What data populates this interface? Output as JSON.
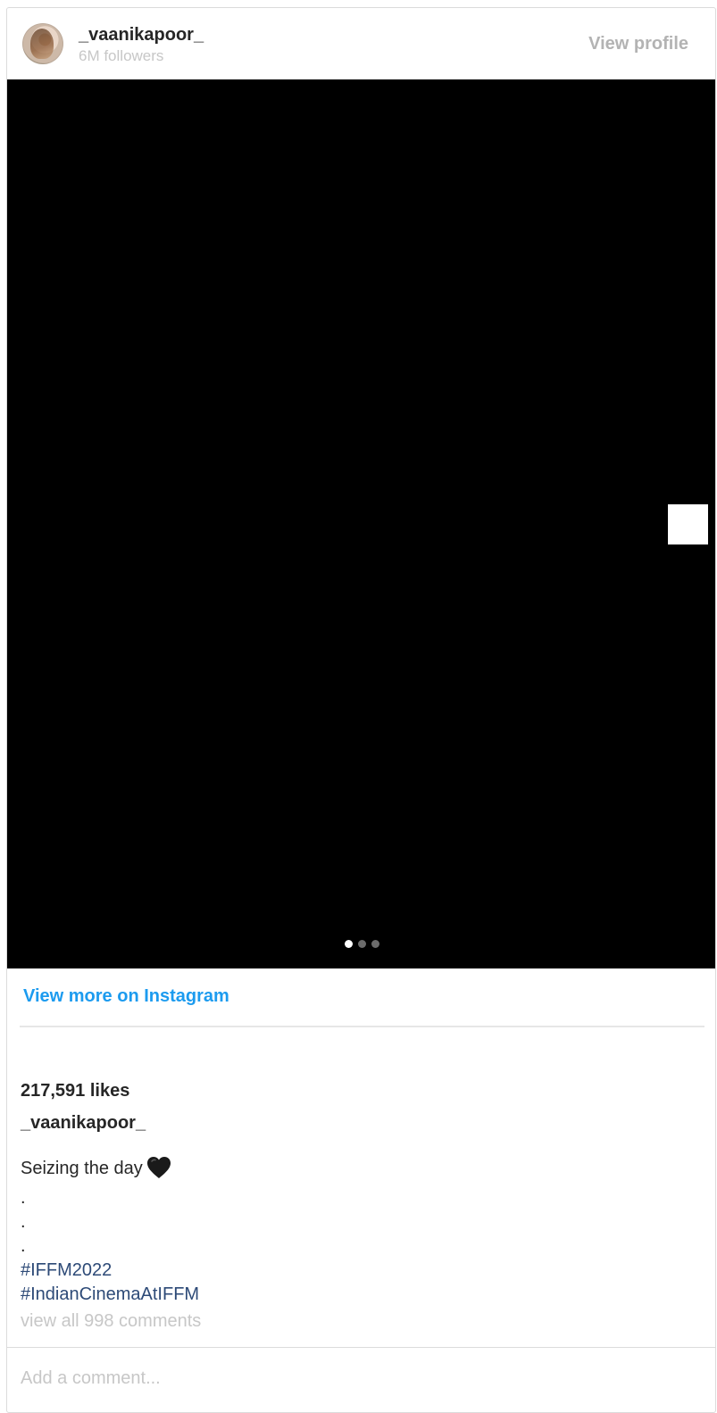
{
  "header": {
    "username": "_vaanikapoor_",
    "followers": "6M followers",
    "view_profile": "View profile"
  },
  "media": {
    "dots_total": 3,
    "active_dot": 1
  },
  "links": {
    "view_more": "View more on Instagram"
  },
  "post": {
    "likes": "217,591 likes",
    "caption_user": "_vaanikapoor_",
    "caption_text": "Seizing the day",
    "caption_dots": [
      ".",
      ".",
      "."
    ],
    "hashtags": [
      "#IFFM2022",
      "#IndianCinemaAtIFFM"
    ],
    "comments_link": "view all 998 comments"
  },
  "comment": {
    "placeholder": "Add a comment..."
  },
  "colors": {
    "link": "#1c9bef",
    "hashtag": "#2d4a77",
    "muted": "#c7c7c7"
  },
  "icons": [
    "black-heart-icon",
    "next-arrow-icon"
  ]
}
